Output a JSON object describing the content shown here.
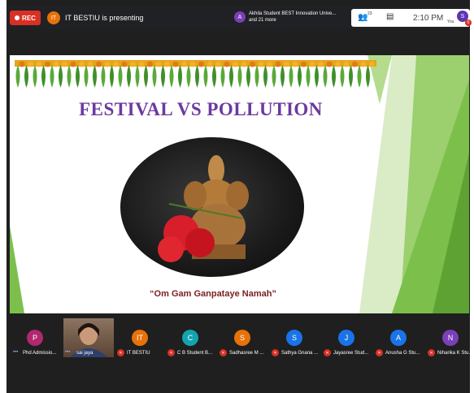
{
  "topbar": {
    "rec_label": "REC",
    "presenter_initials": "IT",
    "presenting_text": "IT BESTIU is presenting",
    "participant_initial": "A",
    "participants_text_line1": "Akhila Student BEST Innovation Unive...",
    "participants_text_line2": "and 21 more",
    "people_count": "23",
    "time": "2:10 PM",
    "you_label": "You",
    "me_initial": "S",
    "me_badge": "0"
  },
  "slide": {
    "title": "FESTIVAL VS POLLUTION",
    "caption": "“Om Gam Ganpataye Namah”",
    "title_color": "#6b3aa0",
    "accent_green": "#7cc04b"
  },
  "participants": [
    {
      "initial": "P",
      "name": "Phd Admissio...",
      "color": "#b0286f"
    },
    {
      "initial": "",
      "name": "sai jaya",
      "color": ""
    },
    {
      "initial": "IT",
      "name": "IT BESTIU",
      "color": "#e8710a"
    },
    {
      "initial": "C",
      "name": "C B Student B...",
      "color": "#12a4af"
    },
    {
      "initial": "S",
      "name": "Sadhasree M ...",
      "color": "#e8710a"
    },
    {
      "initial": "S",
      "name": "Sathya Gnana ...",
      "color": "#1a73e8"
    },
    {
      "initial": "J",
      "name": "Jayasree Stud...",
      "color": "#1a73e8"
    },
    {
      "initial": "A",
      "name": "Anusha G Stu...",
      "color": "#1a73e8"
    },
    {
      "initial": "N",
      "name": "Niharika K Stu...",
      "color": "#7b3fb8"
    }
  ]
}
